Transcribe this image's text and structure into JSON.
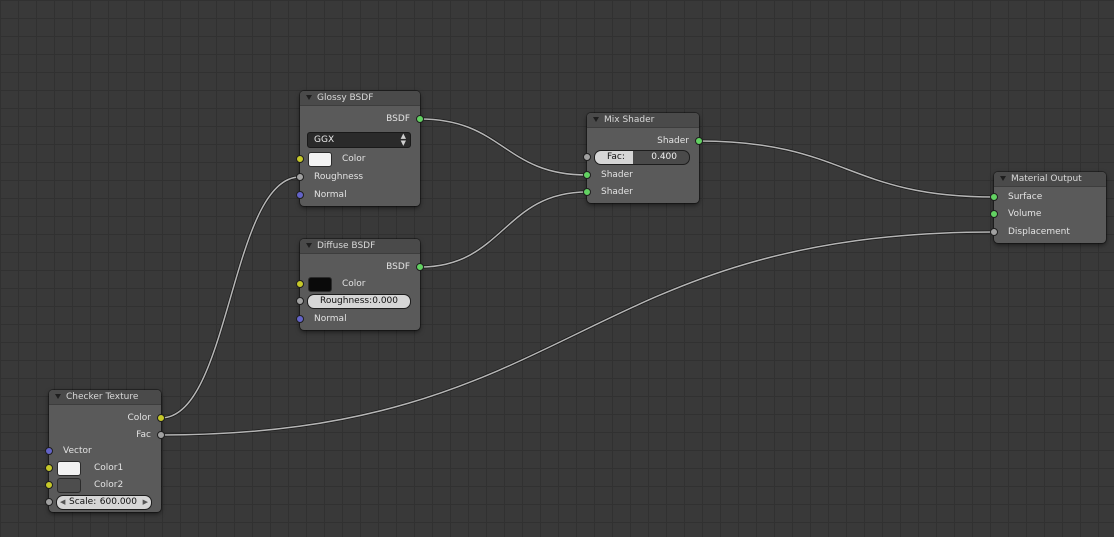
{
  "colors": {
    "socket_shader": "#62d162",
    "socket_color": "#c6c829",
    "socket_float": "#a1a1a1",
    "socket_vector": "#6363c7",
    "link": "#b5b5b5"
  },
  "nodes": {
    "glossy": {
      "title": "Glossy BSDF",
      "output_bsdf": "BSDF",
      "distribution": "GGX",
      "color_label": "Color",
      "color_value": "#f2f2f2",
      "roughness_label": "Roughness",
      "normal_label": "Normal"
    },
    "diffuse": {
      "title": "Diffuse BSDF",
      "output_bsdf": "BSDF",
      "color_label": "Color",
      "color_value": "#0a0a0a",
      "roughness_label": "Roughness:",
      "roughness_value": "0.000",
      "normal_label": "Normal"
    },
    "mix": {
      "title": "Mix Shader",
      "output_shader": "Shader",
      "fac_label": "Fac:",
      "fac_value": "0.400",
      "fac_fraction": 0.4,
      "shader1_label": "Shader",
      "shader2_label": "Shader"
    },
    "output": {
      "title": "Material Output",
      "surface_label": "Surface",
      "volume_label": "Volume",
      "displacement_label": "Displacement"
    },
    "checker": {
      "title": "Checker Texture",
      "output_color": "Color",
      "output_fac": "Fac",
      "vector_label": "Vector",
      "color1_label": "Color1",
      "color1_value": "#f2f2f2",
      "color2_label": "Color2",
      "color2_value": "#4d4d4d",
      "scale_label": "Scale:",
      "scale_value": "600.000"
    }
  }
}
